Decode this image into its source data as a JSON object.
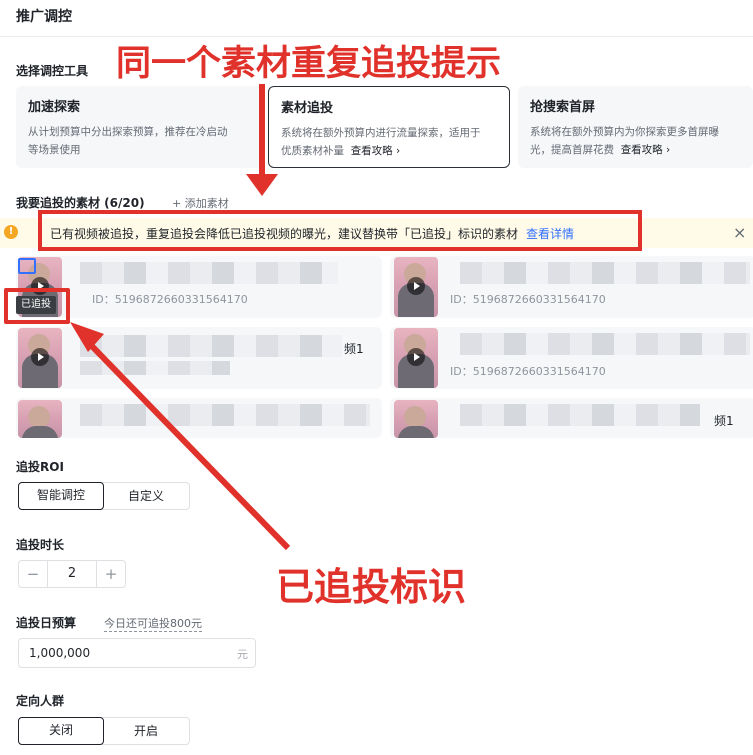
{
  "panel": {
    "title": "推广调控"
  },
  "tools": {
    "label": "选择调控工具",
    "cards": [
      {
        "title": "加速探索",
        "desc_line1": "从计划预算中分出探索预算，推荐在冷启动",
        "desc_line2": "等场景使用",
        "link": ""
      },
      {
        "title": "素材追投",
        "desc_line1": "系统将在额外预算内进行流量探索，适用于",
        "desc_line2": "优质素材补量",
        "link": "查看攻略 ›"
      },
      {
        "title": "抢搜索首屏",
        "desc_line1": "系统将在额外预算内为你探索更多首屏曝",
        "desc_line2": "光，提高首屏花费",
        "link": "查看攻略 ›"
      }
    ]
  },
  "materials": {
    "label": "我要追投的素材 (6/20)",
    "add_label": "+ 添加素材",
    "tag": "已追投",
    "items": [
      {
        "id": "ID：5196872660331564170",
        "suffix": ""
      },
      {
        "id": "ID：5196872660331564170",
        "suffix": ""
      },
      {
        "id": "",
        "suffix": "频1"
      },
      {
        "id": "ID：5196872660331564170",
        "suffix": ""
      },
      {
        "id": "",
        "suffix": ""
      },
      {
        "id": "",
        "suffix": "频1"
      }
    ]
  },
  "alert": {
    "icon": "!",
    "text": "已有视频被追投，重复追投会降低已追投视频的曝光，建议替换带「已追投」标识的素材",
    "link": "查看详情",
    "close": "×"
  },
  "roi": {
    "label": "追投ROI",
    "options": [
      "智能调控",
      "自定义"
    ],
    "selected": 0
  },
  "duration": {
    "label": "追投时长",
    "value": "2",
    "minus": "−",
    "plus": "+"
  },
  "budget": {
    "label": "追投日预算",
    "hint": "今日还可追投800元",
    "value": "1,000,000",
    "unit": "元"
  },
  "audience": {
    "label": "定向人群",
    "options": [
      "关闭",
      "开启"
    ],
    "selected": 0
  },
  "annotations": {
    "top": "同一个素材重复追投提示",
    "bottom": "已追投标识"
  },
  "colors": {
    "annotation": "#e0322b",
    "accent_link": "#3370ff",
    "alert_bg": "#fffbe8",
    "warning": "#f5a623"
  }
}
